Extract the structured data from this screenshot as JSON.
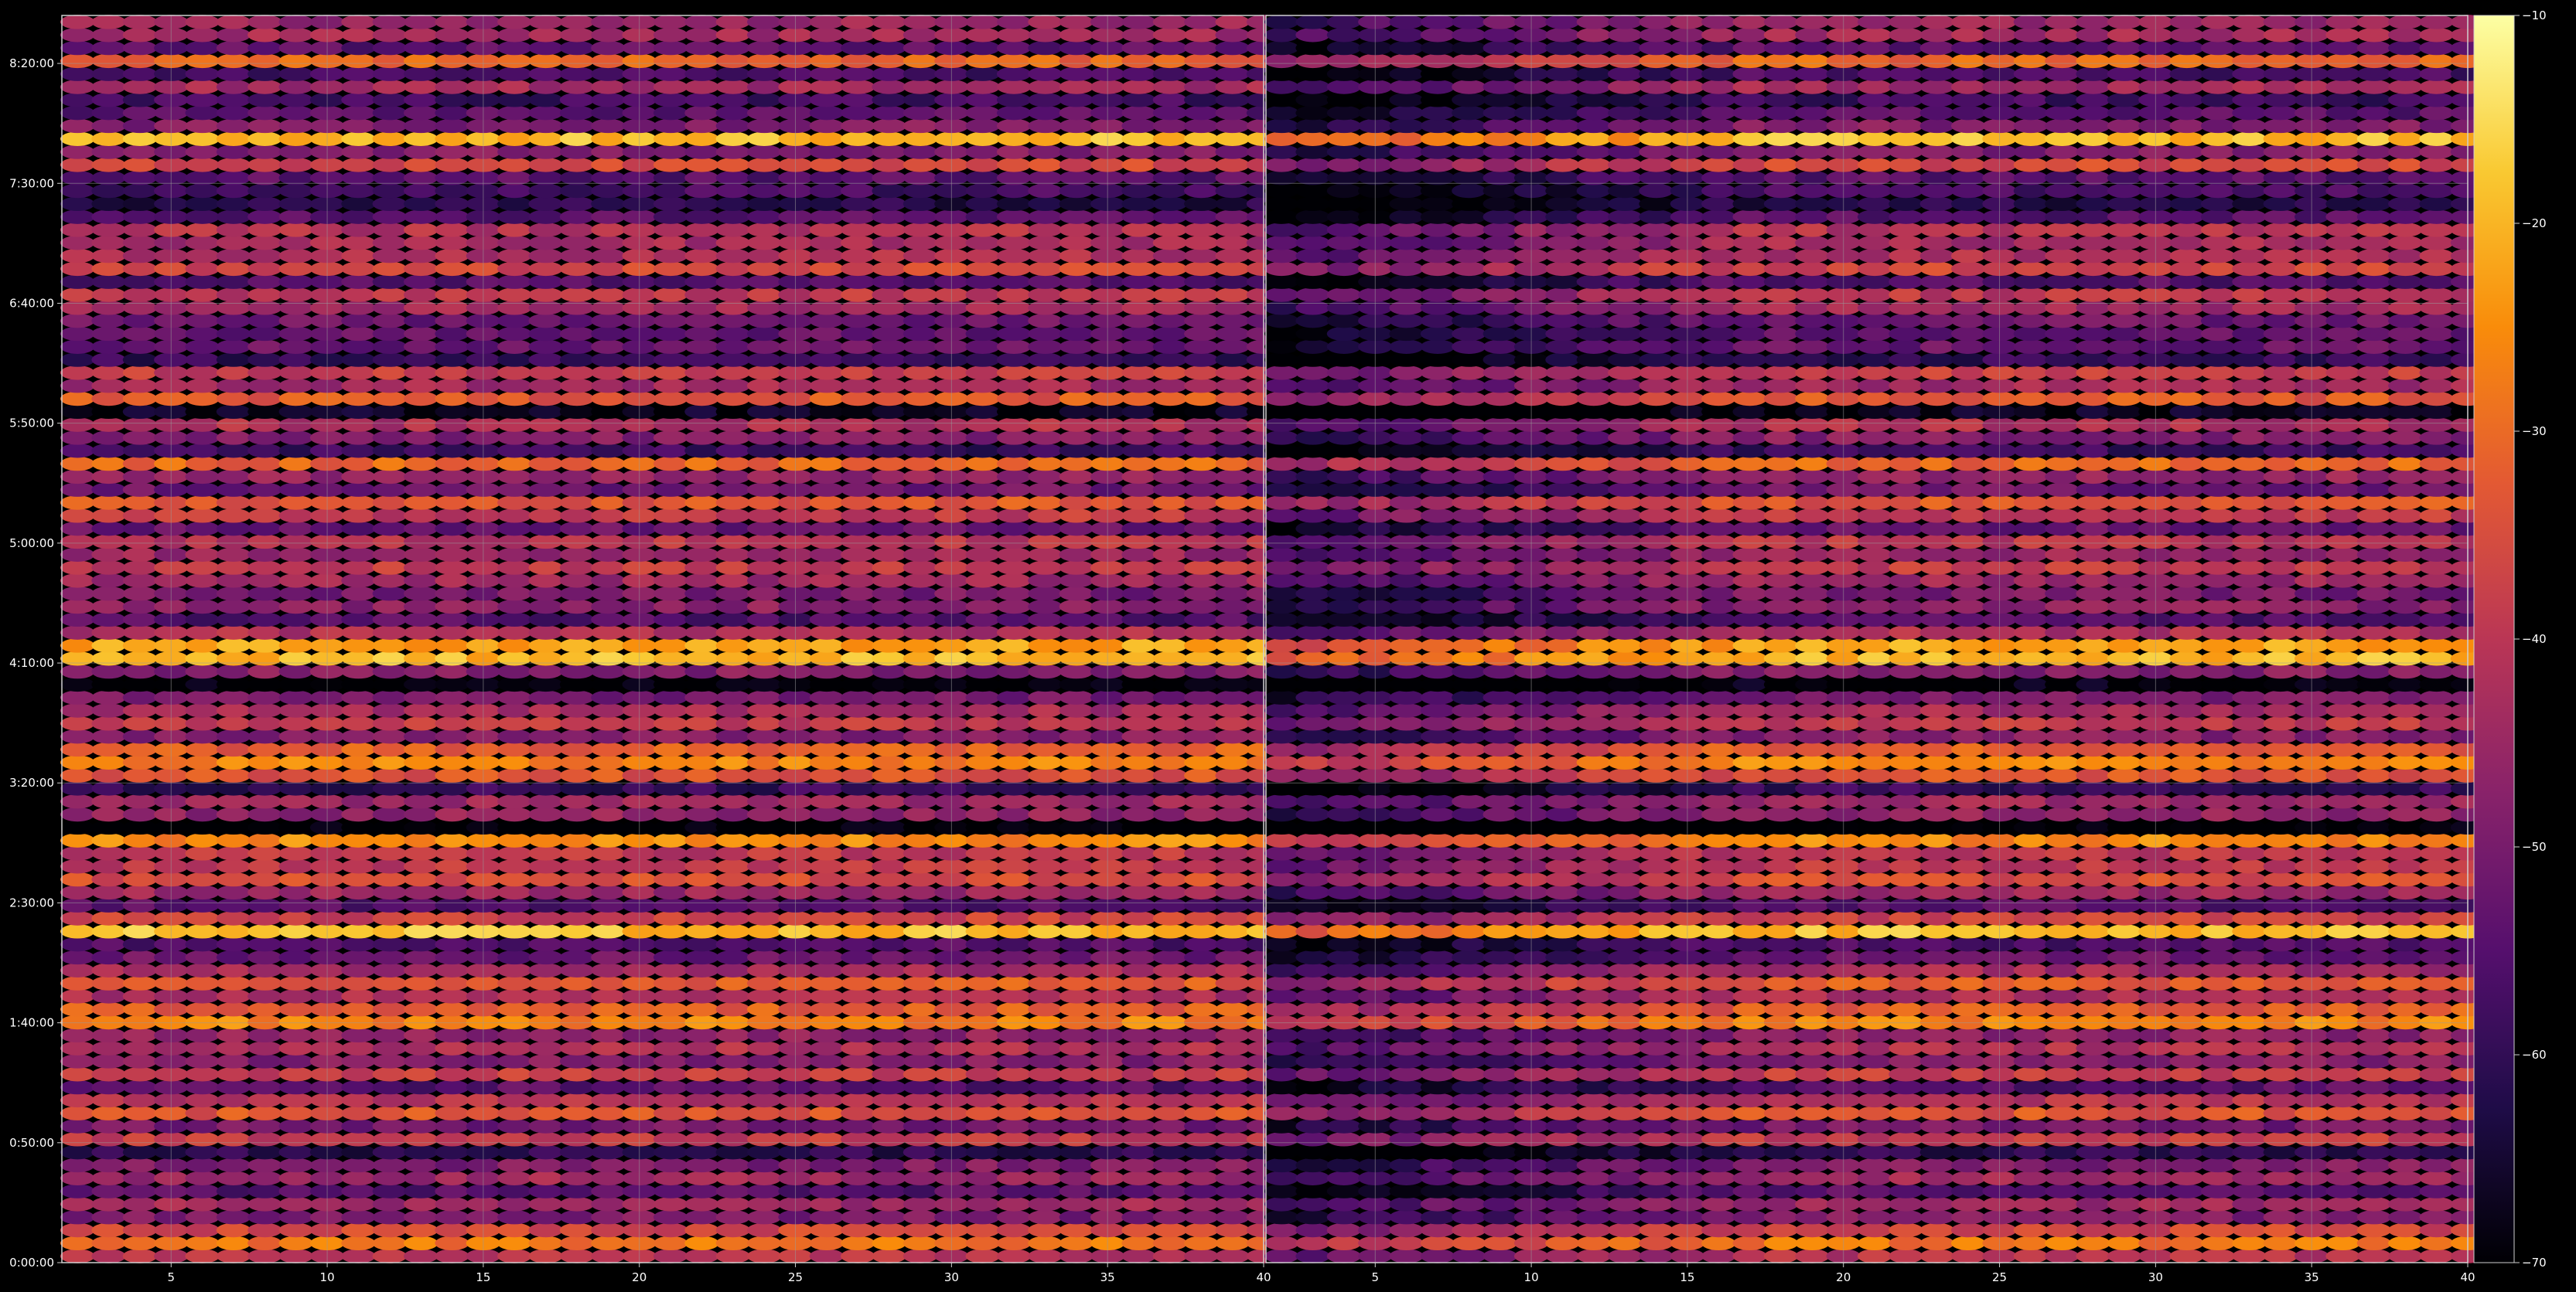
{
  "chart_data": {
    "type": "heatmap",
    "title": "",
    "xlabel": "",
    "ylabel": "",
    "grid": true,
    "background": "#000000",
    "gridColor": "#9a9a9a",
    "colormap": "inferno",
    "colorbar": {
      "min": -70,
      "max": -10,
      "ticks": [
        -10,
        -20,
        -30,
        -40,
        -50,
        -60,
        -70
      ],
      "tickLabels": [
        "−10",
        "−20",
        "−30",
        "−40",
        "−50",
        "−60",
        "−70"
      ],
      "placement": "right"
    },
    "yAxis": {
      "range_minutes": [
        0,
        520
      ],
      "tick_minutes": [
        0,
        50,
        100,
        150,
        200,
        250,
        300,
        350,
        400,
        450,
        500
      ],
      "tickLabels": [
        "0:00:00",
        "0:50:00",
        "1:40:00",
        "2:30:00",
        "3:20:00",
        "4:10:00",
        "5:00:00",
        "5:50:00",
        "6:40:00",
        "7:30:00",
        "8:20:00"
      ]
    },
    "panels": [
      {
        "name": "left",
        "xlim": [
          1.5,
          40
        ],
        "xticks": [
          5,
          10,
          15,
          20,
          25,
          30,
          35,
          40
        ],
        "xtickLabels": [
          "5",
          "10",
          "15",
          "20",
          "25",
          "30",
          "35",
          "40"
        ],
        "columns": [
          2,
          40
        ],
        "row_minutes": [
          0,
          520
        ],
        "row_count": 96
      },
      {
        "name": "right",
        "xlim": [
          1.5,
          40
        ],
        "xticks": [
          5,
          10,
          15,
          20,
          25,
          30,
          35,
          40
        ],
        "xtickLabels": [
          "5",
          "10",
          "15",
          "20",
          "25",
          "30",
          "35",
          "40"
        ],
        "columns": [
          2,
          40
        ],
        "row_minutes": [
          0,
          520
        ],
        "row_count": 96
      }
    ],
    "approx_value_range": [
      -70,
      -10
    ]
  }
}
